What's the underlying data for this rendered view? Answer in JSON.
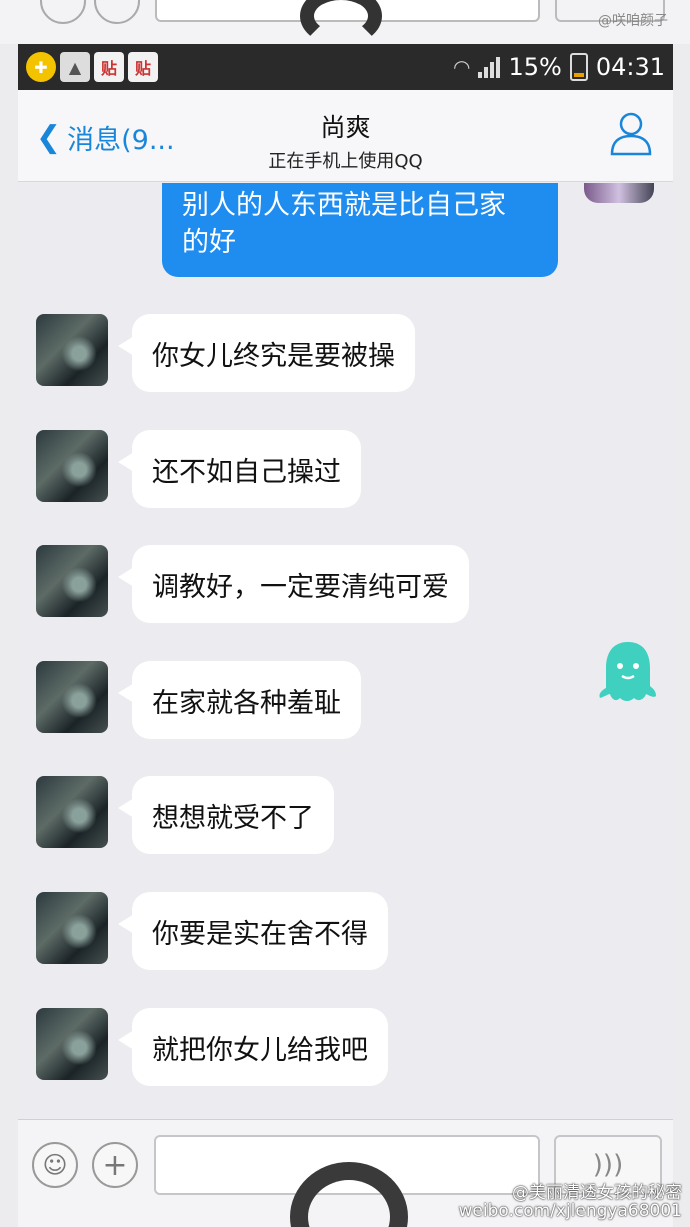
{
  "watermark_top": "@咲咱颜子",
  "status_bar": {
    "app_icons": [
      "贴",
      "贴"
    ],
    "battery": "15%",
    "time": "04:31"
  },
  "nav": {
    "back_label": "消息(9...",
    "title": "尚爽",
    "subtitle": "正在手机上使用QQ"
  },
  "sent_message": {
    "text_line1": "别人的人东西就是比自己家",
    "text_line2": "的好"
  },
  "messages": [
    "你女儿终究是要被操",
    "还不如自己操过",
    "调教好，一定要清纯可爱",
    "在家就各种羞耻",
    "想想就受不了",
    "你要是实在舍不得",
    "就把你女儿给我吧"
  ],
  "icons": {
    "back": "chevron-left-icon",
    "profile": "person-icon",
    "emoji": "smiley-icon",
    "plus": "plus-icon",
    "voice": "voice-icon",
    "ghost": "ghost-sticker-icon"
  },
  "colors": {
    "accent": "#1a86d9",
    "sent_bubble": "#1f8cf0",
    "ghost": "#3fd0c0"
  },
  "watermark_bottom": {
    "line1": "@美丽清透女孩的秘密",
    "line2": "weibo.com/xjlengya68001"
  }
}
